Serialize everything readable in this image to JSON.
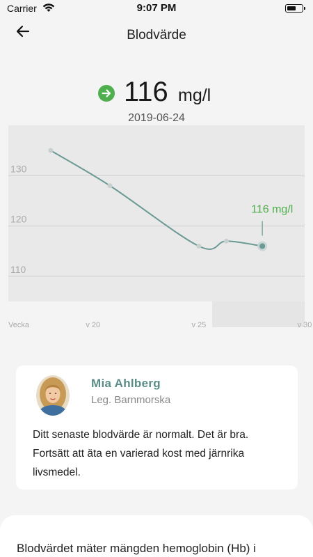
{
  "status_bar": {
    "carrier": "Carrier",
    "time": "9:07 PM"
  },
  "nav": {
    "title": "Blodvärde"
  },
  "latest": {
    "value": "116",
    "unit": "mg/l",
    "date": "2019-06-24",
    "trend_icon": "arrow-right-icon",
    "trend_color": "#4fae4d"
  },
  "chart_data": {
    "type": "line",
    "x_axis_label": "Vecka",
    "x_ticks": [
      "v 20",
      "v 25",
      "v 30"
    ],
    "y_ticks": [
      "130",
      "120",
      "110"
    ],
    "ylim": [
      105,
      140
    ],
    "xlim": [
      16,
      30
    ],
    "series": [
      {
        "x": [
          18,
          20.8,
          25,
          26.3,
          28
        ],
        "values": [
          135,
          128,
          116,
          117,
          116
        ]
      }
    ],
    "annotation": {
      "text": "116 mg/l",
      "x": 28,
      "y": 116
    },
    "line_color": "#6b9994",
    "annotation_color": "#4fae4d"
  },
  "card": {
    "name": "Mia Ahlberg",
    "role": "Leg. Barnmorska",
    "message": "Ditt senaste blodvärde är normalt. Det är bra. Fortsätt att äta en varierad kost med järnrika livsmedel."
  },
  "info_sheet": {
    "text": "Blodvärdet mäter mängden hemoglobin (Hb) i"
  }
}
